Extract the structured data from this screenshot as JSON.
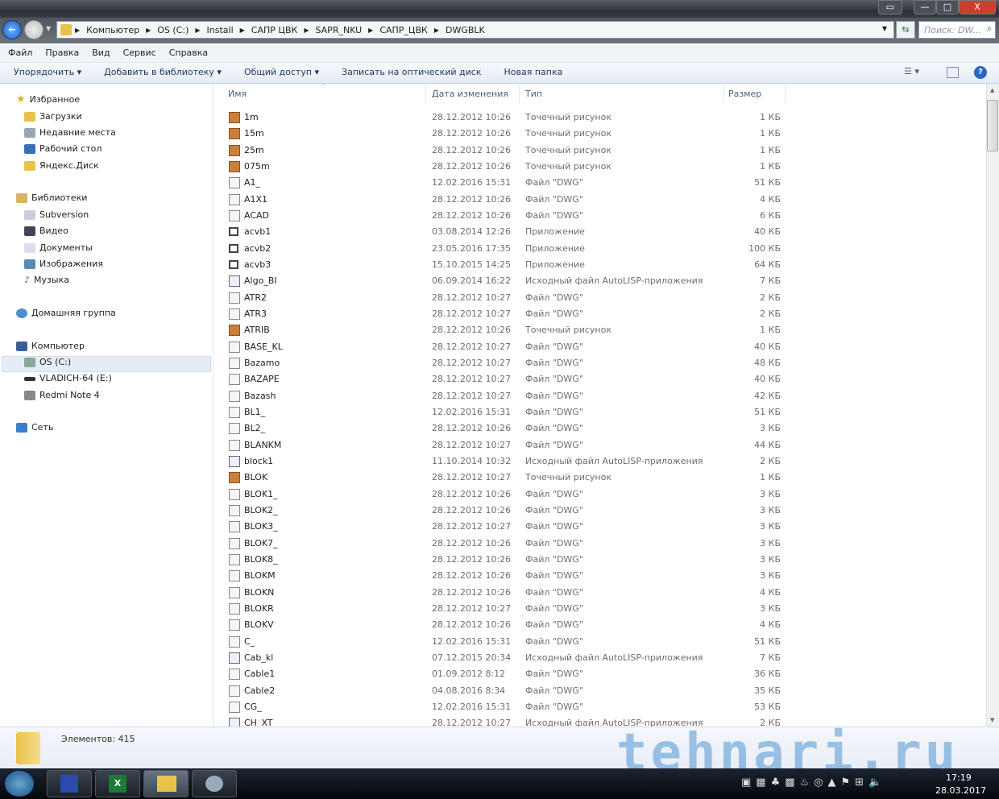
{
  "window": {
    "title_buttons": [
      "▭",
      "—",
      "□",
      "X"
    ]
  },
  "address": {
    "path": [
      "Компьютер",
      "OS (C:)",
      "Install",
      "САПР ЦВК",
      "SAPR_NKU",
      "САПР_ЦВК",
      "DWGBLK"
    ],
    "search_placeholder": "Поиск: DW..."
  },
  "menu": [
    "Файл",
    "Правка",
    "Вид",
    "Сервис",
    "Справка"
  ],
  "commands": [
    "Упорядочить ▾",
    "Добавить в библиотеку ▾",
    "Общий доступ ▾",
    "Записать на оптический диск",
    "Новая папка"
  ],
  "sidebar": {
    "favorites": "Избранное",
    "fav_items": [
      "Загрузки",
      "Недавние места",
      "Рабочий стол",
      "Яндекс.Диск"
    ],
    "libraries": "Библиотеки",
    "lib_items": [
      "Subversion",
      "Видео",
      "Документы",
      "Изображения",
      "Музыка"
    ],
    "homegroup": "Домашняя группа",
    "computer": "Компьютер",
    "comp_items": [
      "OS (C:)",
      "VLADICH-64 (E:)",
      "Redmi Note 4"
    ],
    "network": "Сеть"
  },
  "columns": {
    "name": "Имя",
    "date": "Дата изменения",
    "type": "Тип",
    "size": "Размер"
  },
  "files": [
    [
      "1m",
      "28.12.2012 10:26",
      "Точечный рисунок",
      "1 КБ",
      "bmp"
    ],
    [
      "15m",
      "28.12.2012 10:26",
      "Точечный рисунок",
      "1 КБ",
      "bmp"
    ],
    [
      "25m",
      "28.12.2012 10:26",
      "Точечный рисунок",
      "1 КБ",
      "bmp"
    ],
    [
      "075m",
      "28.12.2012 10:26",
      "Точечный рисунок",
      "1 КБ",
      "bmp"
    ],
    [
      "A1_",
      "12.02.2016 15:31",
      "Файл \"DWG\"",
      "51 КБ",
      "dwg"
    ],
    [
      "A1X1",
      "28.12.2012 10:26",
      "Файл \"DWG\"",
      "4 КБ",
      "dwg"
    ],
    [
      "ACAD",
      "28.12.2012 10:26",
      "Файл \"DWG\"",
      "6 КБ",
      "dwg"
    ],
    [
      "acvb1",
      "03.08.2014 12:26",
      "Приложение",
      "40 КБ",
      "app"
    ],
    [
      "acvb2",
      "23.05.2016 17:35",
      "Приложение",
      "100 КБ",
      "app"
    ],
    [
      "acvb3",
      "15.10.2015 14:25",
      "Приложение",
      "64 КБ",
      "app"
    ],
    [
      "Algo_BI",
      "06.09.2014 16:22",
      "Исходный файл AutoLISP-приложения",
      "7 КБ",
      "lsp"
    ],
    [
      "ATR2",
      "28.12.2012 10:27",
      "Файл \"DWG\"",
      "2 КБ",
      "dwg"
    ],
    [
      "ATR3",
      "28.12.2012 10:27",
      "Файл \"DWG\"",
      "2 КБ",
      "dwg"
    ],
    [
      "ATRIB",
      "28.12.2012 10:26",
      "Точечный рисунок",
      "1 КБ",
      "bmp"
    ],
    [
      "BASE_KL",
      "28.12.2012 10:27",
      "Файл \"DWG\"",
      "40 КБ",
      "dwg"
    ],
    [
      "Bazamo",
      "28.12.2012 10:27",
      "Файл \"DWG\"",
      "48 КБ",
      "dwg"
    ],
    [
      "BAZAPE",
      "28.12.2012 10:27",
      "Файл \"DWG\"",
      "40 КБ",
      "dwg"
    ],
    [
      "Bazash",
      "28.12.2012 10:27",
      "Файл \"DWG\"",
      "42 КБ",
      "dwg"
    ],
    [
      "BL1_",
      "12.02.2016 15:31",
      "Файл \"DWG\"",
      "51 КБ",
      "dwg"
    ],
    [
      "BL2_",
      "28.12.2012 10:26",
      "Файл \"DWG\"",
      "3 КБ",
      "dwg"
    ],
    [
      "BLANKM",
      "28.12.2012 10:27",
      "Файл \"DWG\"",
      "44 КБ",
      "dwg"
    ],
    [
      "block1",
      "11.10.2014 10:32",
      "Исходный файл AutoLISP-приложения",
      "2 КБ",
      "lsp"
    ],
    [
      "BLOK",
      "28.12.2012 10:27",
      "Точечный рисунок",
      "1 КБ",
      "bmp"
    ],
    [
      "BLOK1_",
      "28.12.2012 10:26",
      "Файл \"DWG\"",
      "3 КБ",
      "dwg"
    ],
    [
      "BLOK2_",
      "28.12.2012 10:26",
      "Файл \"DWG\"",
      "3 КБ",
      "dwg"
    ],
    [
      "BLOK3_",
      "28.12.2012 10:27",
      "Файл \"DWG\"",
      "3 КБ",
      "dwg"
    ],
    [
      "BLOK7_",
      "28.12.2012 10:26",
      "Файл \"DWG\"",
      "3 КБ",
      "dwg"
    ],
    [
      "BLOK8_",
      "28.12.2012 10:26",
      "Файл \"DWG\"",
      "3 КБ",
      "dwg"
    ],
    [
      "BLOKM",
      "28.12.2012 10:26",
      "Файл \"DWG\"",
      "3 КБ",
      "dwg"
    ],
    [
      "BLOKN",
      "28.12.2012 10:26",
      "Файл \"DWG\"",
      "4 КБ",
      "dwg"
    ],
    [
      "BLOKR",
      "28.12.2012 10:27",
      "Файл \"DWG\"",
      "3 КБ",
      "dwg"
    ],
    [
      "BLOKV",
      "28.12.2012 10:26",
      "Файл \"DWG\"",
      "4 КБ",
      "dwg"
    ],
    [
      "C_",
      "12.02.2016 15:31",
      "Файл \"DWG\"",
      "51 КБ",
      "dwg"
    ],
    [
      "Cab_kl",
      "07.12.2015 20:34",
      "Исходный файл AutoLISP-приложения",
      "7 КБ",
      "lsp"
    ],
    [
      "Cable1",
      "01.09.2012 8:12",
      "Файл \"DWG\"",
      "36 КБ",
      "dwg"
    ],
    [
      "Cable2",
      "04.08.2016 8:34",
      "Файл \"DWG\"",
      "35 КБ",
      "dwg"
    ],
    [
      "CG_",
      "12.02.2016 15:31",
      "Файл \"DWG\"",
      "53 КБ",
      "dwg"
    ],
    [
      "CH_XT",
      "28.12.2012 10:27",
      "Исходный файл AutoLISP-приложения",
      "2 КБ",
      "lsp"
    ]
  ],
  "status": {
    "count": "Элементов: 415"
  },
  "watermark": "tehnari.ru",
  "tray": {
    "time": "17:19",
    "date": "28.03.2017"
  }
}
